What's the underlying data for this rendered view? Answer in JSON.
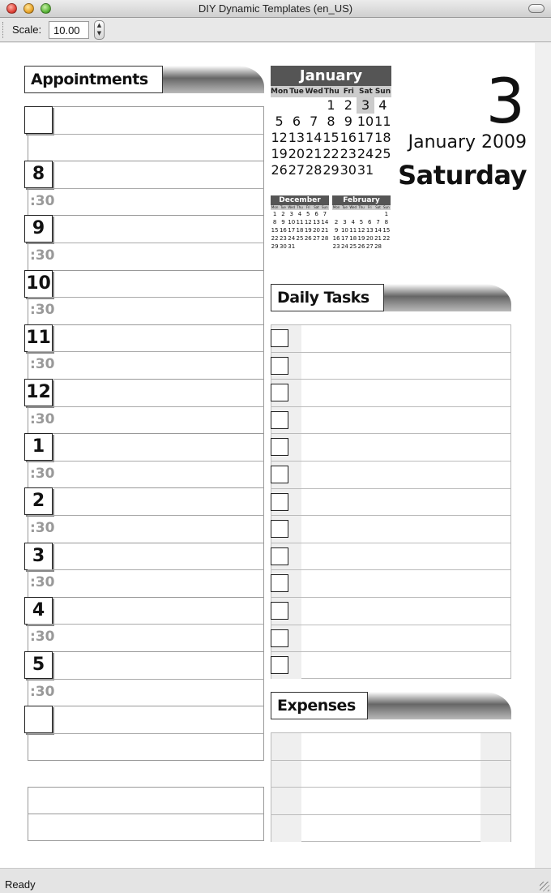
{
  "window": {
    "title": "DIY Dynamic Templates (en_US)"
  },
  "toolbar": {
    "scale_label": "Scale:",
    "scale_value": "10.00"
  },
  "status": {
    "text": "Ready"
  },
  "appointments": {
    "title": "Appointments",
    "hours": [
      "8",
      "9",
      "10",
      "11",
      "12",
      "1",
      "2",
      "3",
      "4",
      "5"
    ],
    "half_label": ":30"
  },
  "calendar": {
    "month": "January",
    "dow": [
      "Mon",
      "Tue",
      "Wed",
      "Thu",
      "Fri",
      "Sat",
      "Sun"
    ],
    "weeks": [
      [
        "",
        "",
        "",
        "1",
        "2",
        "3",
        "4"
      ],
      [
        "5",
        "6",
        "7",
        "8",
        "9",
        "10",
        "11"
      ],
      [
        "12",
        "13",
        "14",
        "15",
        "16",
        "17",
        "18"
      ],
      [
        "19",
        "20",
        "21",
        "22",
        "23",
        "24",
        "25"
      ],
      [
        "26",
        "27",
        "28",
        "29",
        "30",
        "31",
        ""
      ]
    ],
    "selected": "3",
    "prev": {
      "month": "December",
      "dow": [
        "Mon",
        "Tue",
        "Wed",
        "Thu",
        "Fri",
        "Sat",
        "Sun"
      ],
      "weeks": [
        [
          "1",
          "2",
          "3",
          "4",
          "5",
          "6",
          "7"
        ],
        [
          "8",
          "9",
          "10",
          "11",
          "12",
          "13",
          "14"
        ],
        [
          "15",
          "16",
          "17",
          "18",
          "19",
          "20",
          "21"
        ],
        [
          "22",
          "23",
          "24",
          "25",
          "26",
          "27",
          "28"
        ],
        [
          "29",
          "30",
          "31",
          "",
          "",
          "",
          ""
        ]
      ]
    },
    "next": {
      "month": "February",
      "dow": [
        "Mon",
        "Tue",
        "Wed",
        "Thu",
        "Fri",
        "Sat",
        "Sun"
      ],
      "weeks": [
        [
          "",
          "",
          "",
          "",
          "",
          "",
          "1"
        ],
        [
          "2",
          "3",
          "4",
          "5",
          "6",
          "7",
          "8"
        ],
        [
          "9",
          "10",
          "11",
          "12",
          "13",
          "14",
          "15"
        ],
        [
          "16",
          "17",
          "18",
          "19",
          "20",
          "21",
          "22"
        ],
        [
          "23",
          "24",
          "25",
          "26",
          "27",
          "28",
          ""
        ]
      ]
    }
  },
  "date": {
    "day": "3",
    "month_year": "January 2009",
    "weekday": "Saturday"
  },
  "tasks": {
    "title": "Daily Tasks",
    "count": 13
  },
  "expenses": {
    "title": "Expenses",
    "count": 4
  }
}
